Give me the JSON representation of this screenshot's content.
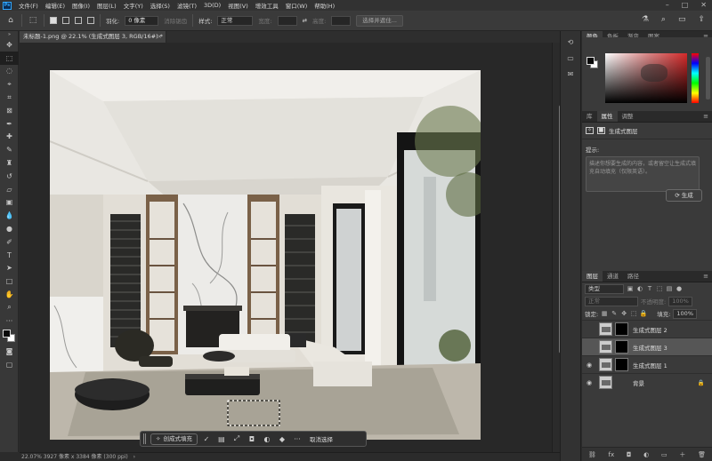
{
  "app": {
    "logo": "Ps"
  },
  "menu": [
    "文件(F)",
    "编辑(E)",
    "图像(I)",
    "图层(L)",
    "文字(Y)",
    "选择(S)",
    "滤镜(T)",
    "3D(D)",
    "视图(V)",
    "增效工具",
    "窗口(W)",
    "帮助(H)"
  ],
  "options": {
    "feather_label": "羽化:",
    "feather_value": "0 像素",
    "antialias": "消除锯齿",
    "style_label": "样式:",
    "style_value": "正常",
    "width_label": "宽度:",
    "height_label": "高度:",
    "select_mask": "选择并遮住..."
  },
  "document": {
    "tab_title": "未标题-1.png @ 22.1% (生成式图层 3, RGB/16#) *"
  },
  "taskbar": {
    "generative_fill": "创成式填充",
    "cancel_selection": "取消选择"
  },
  "status": {
    "text": "22.07%   3927 像素 x 3384 像素 (300 ppi)"
  },
  "color_panel": {
    "tabs": [
      "颜色",
      "色板",
      "渐变",
      "图案"
    ],
    "accent": "#d52a2a",
    "swatches": [
      "#e8322f",
      "#2c7be5",
      "#2ab7ca",
      "#5bbd4a",
      "#e6c229"
    ]
  },
  "properties": {
    "tabs": [
      "库",
      "属性",
      "调整"
    ],
    "layer_type": "生成式图层",
    "prompt_label": "提示:",
    "prompt_placeholder": "描述你想要生成的内容，或者留空让生成式填充自动填充（仅限英语）。",
    "generate_button": "生成"
  },
  "layers": {
    "tabs": [
      "图层",
      "通道",
      "路径"
    ],
    "kind_filter": "类型",
    "blend_mode": "正常",
    "opacity_label": "不透明度:",
    "opacity_value": "100%",
    "lock_label": "锁定:",
    "fill_label": "填充:",
    "fill_value": "100%",
    "items": [
      {
        "name": "生成式图层 2",
        "visible": false,
        "selected": false
      },
      {
        "name": "生成式图层 3",
        "visible": false,
        "selected": true
      },
      {
        "name": "生成式图层 1",
        "visible": true,
        "selected": false
      },
      {
        "name": "背景",
        "visible": true,
        "selected": false,
        "locked": true
      }
    ]
  }
}
